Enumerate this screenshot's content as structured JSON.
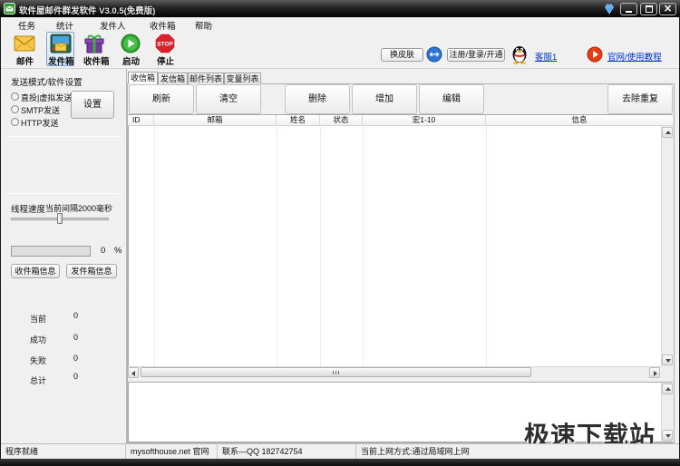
{
  "window": {
    "title": "软件屋邮件群发软件 V3.0.5(免费版)",
    "app_icon": "app-envelope-icon",
    "title_right_icon": "blue-gem-icon",
    "controls": {
      "minimize": "minimize-icon",
      "maximize": "maximize-icon",
      "close": "close-icon"
    }
  },
  "menu": [
    {
      "label": "任务"
    },
    {
      "label": "统计"
    },
    {
      "label": "发件人"
    },
    {
      "label": "收件箱"
    },
    {
      "label": "帮助"
    }
  ],
  "toolbar": {
    "items": [
      {
        "label": "邮件",
        "icon": "envelope-icon",
        "selected": false
      },
      {
        "label": "发件箱",
        "icon": "outbox-icon",
        "selected": true
      },
      {
        "label": "收件箱",
        "icon": "gift-box-icon",
        "selected": false
      },
      {
        "label": "启动",
        "icon": "play-green-icon",
        "selected": false
      },
      {
        "label": "停止",
        "icon": "stop-sign-icon",
        "selected": false
      }
    ],
    "stop_sign_text": "STOP",
    "skin_button": "换皮肤",
    "switch_icon": "blue-arrows-icon",
    "register_button": "注册/登录/开通",
    "qq_icon": "qq-penguin-icon",
    "support_link": "客服1",
    "website_icon": "red-play-icon",
    "website_link": "官网/使用教程",
    "link_color": "#0033cc"
  },
  "left_panel": {
    "send_mode_title": "发送模式/软件设置",
    "send_modes": [
      {
        "label": "直投|虚拟发送",
        "checked": false
      },
      {
        "label": "SMTP发送",
        "checked": false
      },
      {
        "label": "HTTP发送",
        "checked": false
      }
    ],
    "settings_button": "设置",
    "thread_speed": {
      "label": "线程速度",
      "interval_text": "当前间隔2000毫秒",
      "slider_fraction": 0.5
    },
    "progress": {
      "value": "0",
      "unit": "%",
      "fraction": 0
    },
    "inbox_info_button": "收件箱信息",
    "outbox_info_button": "发件箱信息",
    "stats": [
      {
        "label": "当前",
        "value": "0"
      },
      {
        "label": "成功",
        "value": "0"
      },
      {
        "label": "失败",
        "value": "0"
      },
      {
        "label": "总计",
        "value": "0"
      }
    ]
  },
  "tabs": [
    {
      "label": "收信箱",
      "active": true
    },
    {
      "label": "发信箱",
      "active": false
    },
    {
      "label": "邮件列表",
      "active": false
    },
    {
      "label": "变量列表",
      "active": false
    }
  ],
  "actions": {
    "refresh": "刷新",
    "clear": "清空",
    "delete": "删除",
    "add": "增加",
    "edit": "编辑",
    "dedupe": "去除重复"
  },
  "table": {
    "columns": [
      "ID",
      "邮箱",
      "姓名",
      "状态",
      "宏1-10",
      "信息"
    ],
    "rows": []
  },
  "watermark": "极速下载站",
  "status_bar": [
    "程序就绪",
    "mysofthouse.net 官网",
    "联系—QQ 182742754",
    "当前上网方式:通过局域网上网"
  ]
}
